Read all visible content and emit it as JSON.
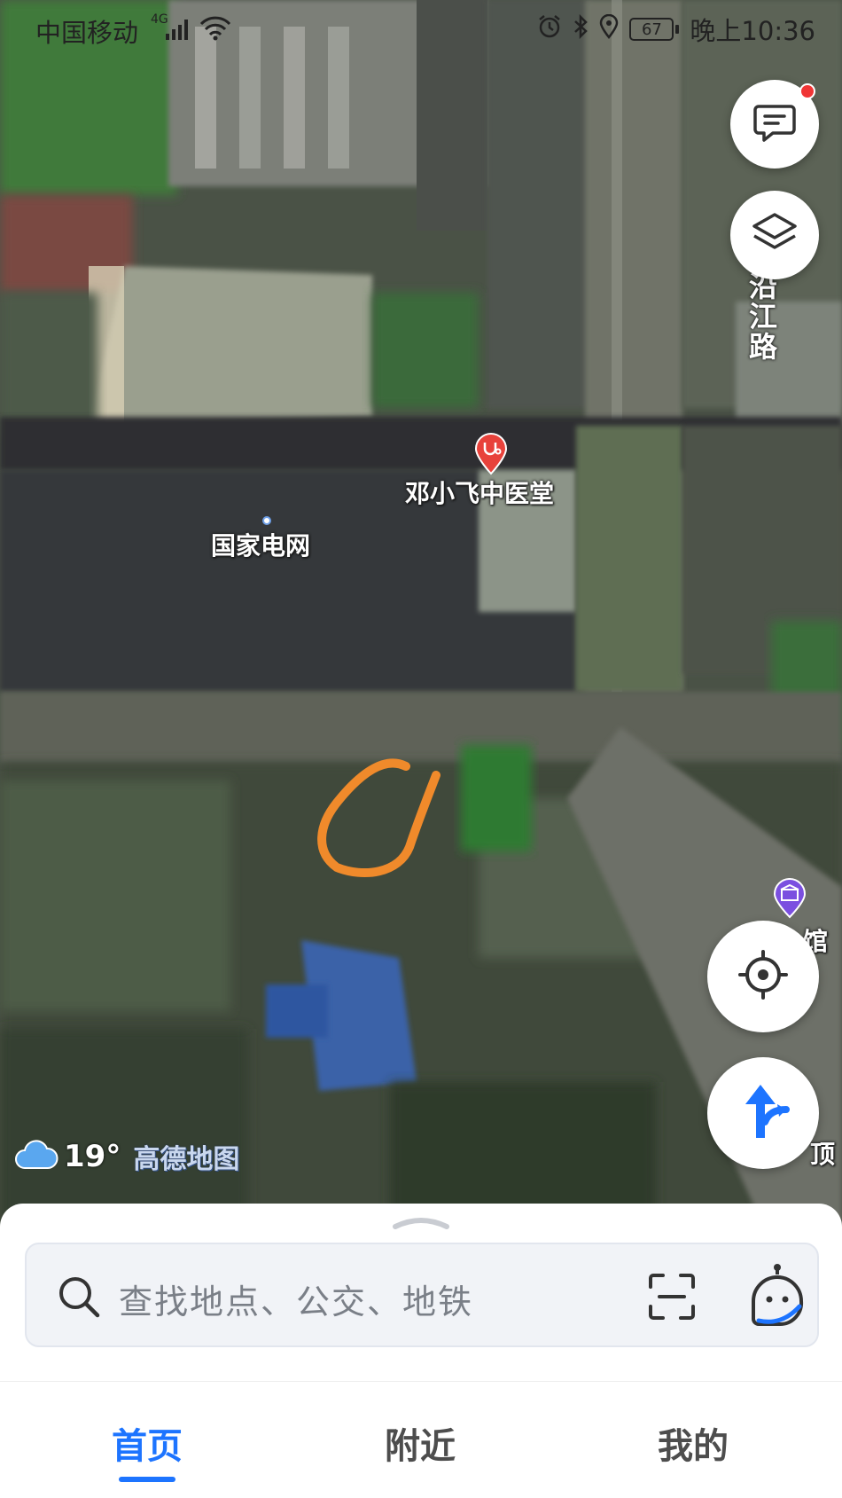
{
  "status_bar": {
    "carrier": "中国移动",
    "network": "4G",
    "battery": "67",
    "time": "晚上10:36"
  },
  "map": {
    "labels": {
      "clinic": "邓小飞中医堂",
      "power_grid": "国家电网",
      "road": "沿江路",
      "hotel_partial": "馆",
      "right_edge_partial": "顶"
    },
    "icons": {
      "clinic_pin": "stethoscope-pin-icon",
      "hotel_pin": "hotel-pin-icon"
    }
  },
  "controls": {
    "feedback": "chat-feedback-icon",
    "layers": "layers-icon",
    "locate": "locate-target-icon",
    "navigate": "route-arrow-icon",
    "has_notification": true
  },
  "weather": {
    "icon": "cloud-icon",
    "temperature": "19°",
    "brand": "高德地图"
  },
  "search": {
    "placeholder": "查找地点、公交、地铁",
    "scan_icon": "scan-icon",
    "assistant_icon": "assistant-robot-icon"
  },
  "tabs": [
    {
      "label": "首页",
      "active": true
    },
    {
      "label": "附近",
      "active": false
    },
    {
      "label": "我的",
      "active": false
    }
  ],
  "colors": {
    "accent": "#1d74ff",
    "annotation": "#f08a2b",
    "poi_red": "#e8423b",
    "poi_purple": "#7b4fe0"
  }
}
